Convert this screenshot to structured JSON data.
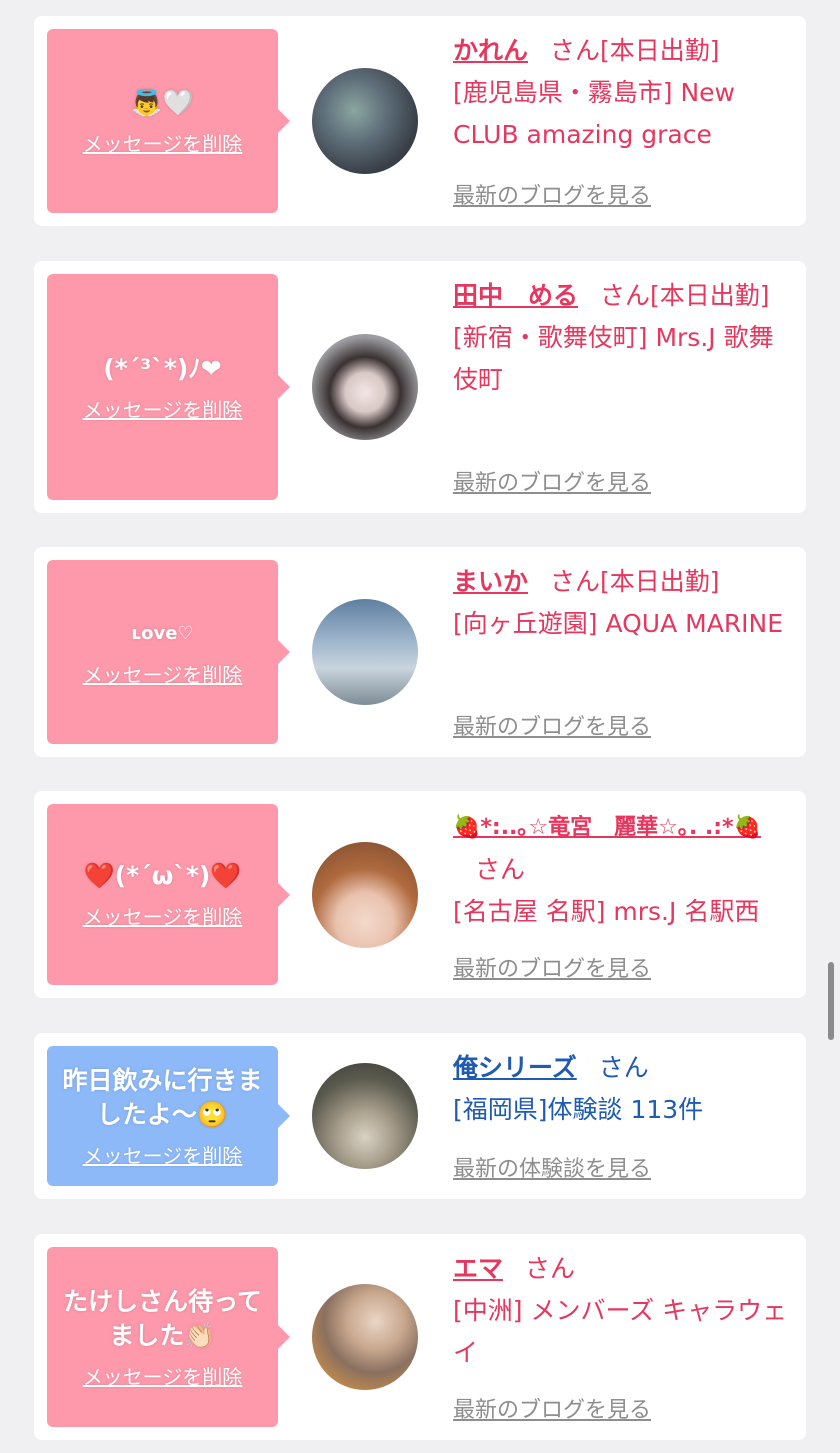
{
  "delete_label": "メッセージを削除",
  "colors": {
    "pink_bubble": "#fd99ab",
    "blue_bubble": "#8db9f9",
    "name_pink": "#e6375e",
    "name_blue": "#1f5bb0",
    "link_gray": "#8e8e8e"
  },
  "cards": [
    {
      "message": "👼🤍",
      "name": "かれん",
      "honorific": "さん",
      "status": "[本日出勤]",
      "location": "[鹿児島県・霧島市] New CLUB amazing grace",
      "link": "最新のブログを見る"
    },
    {
      "message": "(*´³`*)ﾉ❤︎",
      "name": "田中　める",
      "honorific": "さん",
      "status": "[本日出勤]",
      "location": "[新宿・歌舞伎町] Mrs.J 歌舞伎町",
      "link": "最新のブログを見る"
    },
    {
      "message": "ʟove♡",
      "name": "まいか",
      "honorific": "さん",
      "status": "[本日出勤]",
      "location": "[向ヶ丘遊園] AQUA MARINE",
      "link": "最新のブログを見る"
    },
    {
      "message": "❤️(*´ω`*)❤️",
      "name": "🍓*:..｡☆竜宮　麗華☆｡. .:*🍓",
      "honorific": "さん",
      "status": "",
      "location": "[名古屋 名駅] mrs.J 名駅西",
      "link": "最新のブログを見る"
    },
    {
      "message": "昨日飲みに行きましたよ〜🙄",
      "name": "俺シリーズ",
      "honorific": "さん",
      "status": "",
      "location": "[福岡県]体験談 113件",
      "link": "最新の体験談を見る"
    },
    {
      "message": "たけしさん待ってました👏🏻",
      "name": "エマ",
      "honorific": "さん",
      "status": "",
      "location": "[中洲] メンバーズ キャラウェイ",
      "link": "最新のブログを見る"
    }
  ]
}
